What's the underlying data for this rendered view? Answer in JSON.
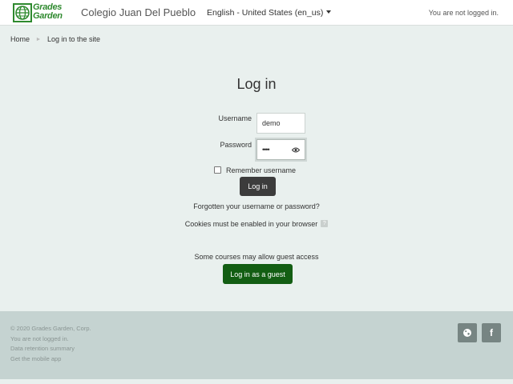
{
  "header": {
    "logo_line1": "Grades",
    "logo_line2": "Garden",
    "site_name": "Colegio Juan Del Pueblo",
    "language": "English - United States (en_us)",
    "login_status": "You are not logged in."
  },
  "breadcrumb": {
    "home": "Home",
    "current": "Log in to the site"
  },
  "login": {
    "title": "Log in",
    "username_label": "Username",
    "username_value": "demo",
    "password_label": "Password",
    "password_mask": "••••",
    "remember_label": "Remember username",
    "remember_checked": false,
    "login_button": "Log in",
    "forgot_link": "Forgotten your username or password?",
    "cookies_text": "Cookies must be enabled in your browser",
    "help_symbol": "?",
    "guest_note": "Some courses may allow guest access",
    "guest_button": "Log in as a guest"
  },
  "footer": {
    "copyright": "© 2020 Grades Garden, Corp.",
    "login_status": "You are not logged in.",
    "data_retention": "Data retention summary",
    "mobile_app": "Get the mobile app",
    "social_icons": [
      "globe-icon",
      "facebook-icon"
    ],
    "facebook_glyph": "f"
  },
  "colors": {
    "page_bg": "#e9f0ee",
    "footer_bg": "#c5d3d1",
    "brand_green": "#2f8a2f",
    "guest_button": "#135e13",
    "login_button": "#3c3c3c"
  }
}
